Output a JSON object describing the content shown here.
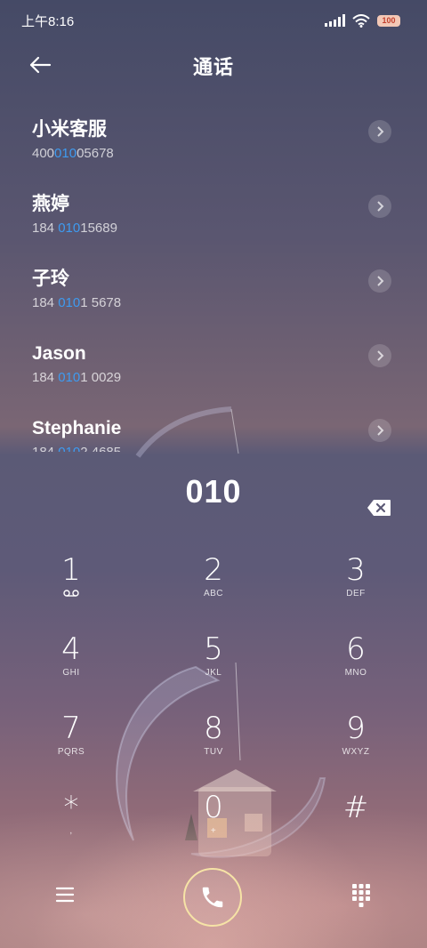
{
  "status_bar": {
    "time": "上午8:16",
    "battery": "100"
  },
  "header": {
    "title": "通话"
  },
  "results": [
    {
      "name": "小米客服",
      "number_pre": "400",
      "number_hl": "010",
      "number_post": "05678"
    },
    {
      "name": "燕婷",
      "number_pre": "184 ",
      "number_hl": "010",
      "number_post": "15689"
    },
    {
      "name": "子玲",
      "number_pre": "184 ",
      "number_hl": "010",
      "number_post": "1 5678"
    },
    {
      "name": "Jason",
      "number_pre": "184 ",
      "number_hl": "010",
      "number_post": "1 0029"
    },
    {
      "name": "Stephanie",
      "number_pre": "184 ",
      "number_hl": "010",
      "number_post": "2 4685"
    }
  ],
  "dialer": {
    "input": "010",
    "keys": [
      {
        "digit": "1",
        "letters": ""
      },
      {
        "digit": "2",
        "letters": "ABC"
      },
      {
        "digit": "3",
        "letters": "DEF"
      },
      {
        "digit": "4",
        "letters": "GHI"
      },
      {
        "digit": "5",
        "letters": "JKL"
      },
      {
        "digit": "6",
        "letters": "MNO"
      },
      {
        "digit": "7",
        "letters": "PQRS"
      },
      {
        "digit": "8",
        "letters": "TUV"
      },
      {
        "digit": "9",
        "letters": "WXYZ"
      },
      {
        "digit": "*",
        "letters": ","
      },
      {
        "digit": "0",
        "letters": "+"
      },
      {
        "digit": "#",
        "letters": ""
      }
    ]
  },
  "colors": {
    "highlight": "#3e9bf0",
    "call_ring": "#f6e3a6"
  },
  "icons": {
    "back": "arrow-left-icon",
    "chevron": "chevron-right-icon",
    "backspace": "backspace-icon",
    "voicemail": "voicemail-icon",
    "menu": "menu-icon",
    "call": "phone-icon",
    "keypad": "keypad-icon"
  }
}
